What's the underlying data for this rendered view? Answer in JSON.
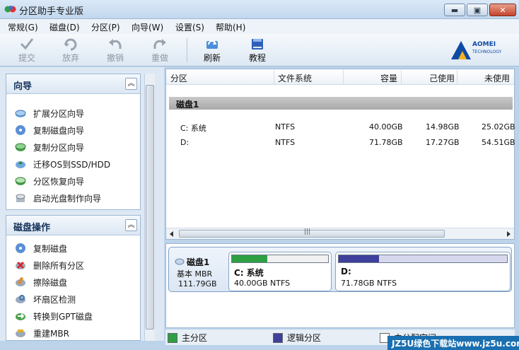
{
  "window": {
    "title": "分区助手专业版",
    "minimize": "▬",
    "maximize": "▣",
    "close": "✕"
  },
  "menu": [
    "常规(G)",
    "磁盘(D)",
    "分区(P)",
    "向导(W)",
    "设置(S)",
    "帮助(H)"
  ],
  "toolbar": {
    "submit": "提交",
    "discard": "放弃",
    "undo": "撤销",
    "redo": "重做",
    "refresh": "刷新",
    "tutorial": "教程"
  },
  "brand": {
    "name": "AOMEI",
    "sub": "TECHNOLOGY"
  },
  "sidebar": {
    "wizard_panel": {
      "title": "向导",
      "items": [
        "扩展分区向导",
        "复制磁盘向导",
        "复制分区向导",
        "迁移OS到SSD/HDD",
        "分区恢复向导",
        "启动光盘制作向导"
      ]
    },
    "disk_panel": {
      "title": "磁盘操作",
      "items": [
        "复制磁盘",
        "删除所有分区",
        "擦除磁盘",
        "坏扇区检测",
        "转换到GPT磁盘",
        "重建MBR"
      ]
    },
    "collapse_glyph": "︽"
  },
  "list": {
    "columns": [
      "分区",
      "文件系统",
      "容量",
      "己使用",
      "未使用"
    ],
    "group": "磁盘1",
    "rows": [
      {
        "partition": "C: 系统",
        "fs": "NTFS",
        "capacity": "40.00GB",
        "used": "14.98GB",
        "free": "25.02GB"
      },
      {
        "partition": "D:",
        "fs": "NTFS",
        "capacity": "71.78GB",
        "used": "17.27GB",
        "free": "54.51GB"
      }
    ],
    "scroll_grip": "|||"
  },
  "diskmap": {
    "disk_name": "磁盘1",
    "disk_type": "基本 MBR",
    "disk_size": "111.79GB",
    "partitions": [
      {
        "name": "C: 系统",
        "info": "40.00GB NTFS",
        "used_fraction": 0.37,
        "color": "#2ea043"
      },
      {
        "name": "D:",
        "info": "71.78GB NTFS",
        "used_fraction": 0.24,
        "color": "#3e3f9b"
      }
    ]
  },
  "legend": {
    "primary": "主分区",
    "logical": "逻辑分区",
    "unallocated": "未分配空间"
  },
  "watermark": "JZ5U绿色下载站www.jz5u.com"
}
